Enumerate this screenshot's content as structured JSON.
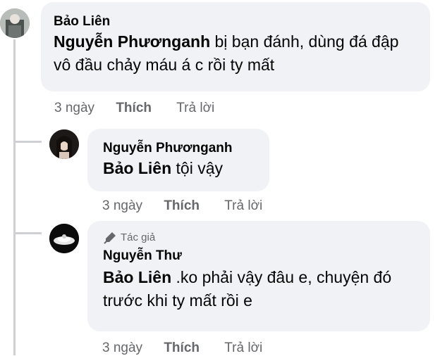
{
  "comments": [
    {
      "author": "Bảo Liên",
      "mention": "Nguyễn Phươnganh",
      "text": " bị bạn đánh, dùng đá đập vô đầu chảy máu á c rồi ty mất",
      "time": "3 ngày",
      "like": "Thích",
      "reply": "Trả lời"
    },
    {
      "author": "Nguyễn Phươnganh",
      "mention": "Bảo Liên",
      "text": " tội vậy",
      "time": "3 ngày",
      "like": "Thích",
      "reply": "Trả lời"
    },
    {
      "badge": "Tác giả",
      "author": "Nguyễn Thư",
      "mention": "Bảo Liên",
      "text": " .ko phải vậy đâu e, chuyện đó trước khi ty mất rồi e",
      "time": "3 ngày",
      "like": "Thích",
      "reply": "Trả lời"
    }
  ],
  "colors": {
    "bubble": "#f0f2f5",
    "meta": "#65676b",
    "thread": "#ced0d4"
  }
}
